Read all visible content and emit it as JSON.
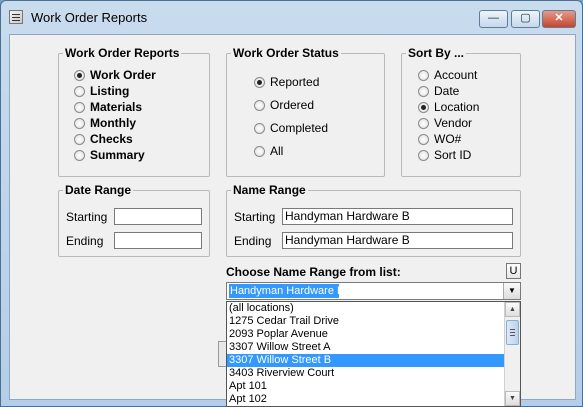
{
  "window": {
    "title": "Work Order Reports",
    "controls": {
      "minimize": "—",
      "maximize": "▢",
      "close": "✕"
    }
  },
  "reports": {
    "legend": "Work Order Reports",
    "options": [
      {
        "label": "Work Order",
        "selected": true
      },
      {
        "label": "Listing",
        "selected": false
      },
      {
        "label": "Materials",
        "selected": false
      },
      {
        "label": "Monthly",
        "selected": false
      },
      {
        "label": "Checks",
        "selected": false
      },
      {
        "label": "Summary",
        "selected": false
      }
    ]
  },
  "status": {
    "legend": "Work Order Status",
    "options": [
      {
        "label": "Reported",
        "selected": true
      },
      {
        "label": "Ordered",
        "selected": false
      },
      {
        "label": "Completed",
        "selected": false
      },
      {
        "label": "All",
        "selected": false
      }
    ]
  },
  "sort": {
    "legend": "Sort By ...",
    "options": [
      {
        "label": "Account",
        "selected": false
      },
      {
        "label": "Date",
        "selected": false
      },
      {
        "label": "Location",
        "selected": true
      },
      {
        "label": "Vendor",
        "selected": false
      },
      {
        "label": "WO#",
        "selected": false
      },
      {
        "label": "Sort ID",
        "selected": false
      }
    ]
  },
  "date_range": {
    "legend": "Date Range",
    "starting_label": "Starting",
    "ending_label": "Ending",
    "starting_value": "",
    "ending_value": ""
  },
  "name_range": {
    "legend": "Name Range",
    "starting_label": "Starting",
    "ending_label": "Ending",
    "starting_value": "Handyman Hardware B",
    "ending_value": "Handyman Hardware B"
  },
  "chooser": {
    "label": "Choose Name Range from list:",
    "u_button": "U",
    "selected_value": "Handyman Hardware B",
    "list": [
      "(all locations)",
      "1275 Cedar Trail Drive",
      "2093 Poplar Avenue",
      "3307 Willow Street A",
      "3307 Willow Street B",
      "3403 Riverview Court",
      "Apt 101",
      "Apt 102"
    ],
    "highlighted_index": 4
  },
  "colors": {
    "selection": "#3399ff",
    "client_bg": "#f0f0f0"
  }
}
